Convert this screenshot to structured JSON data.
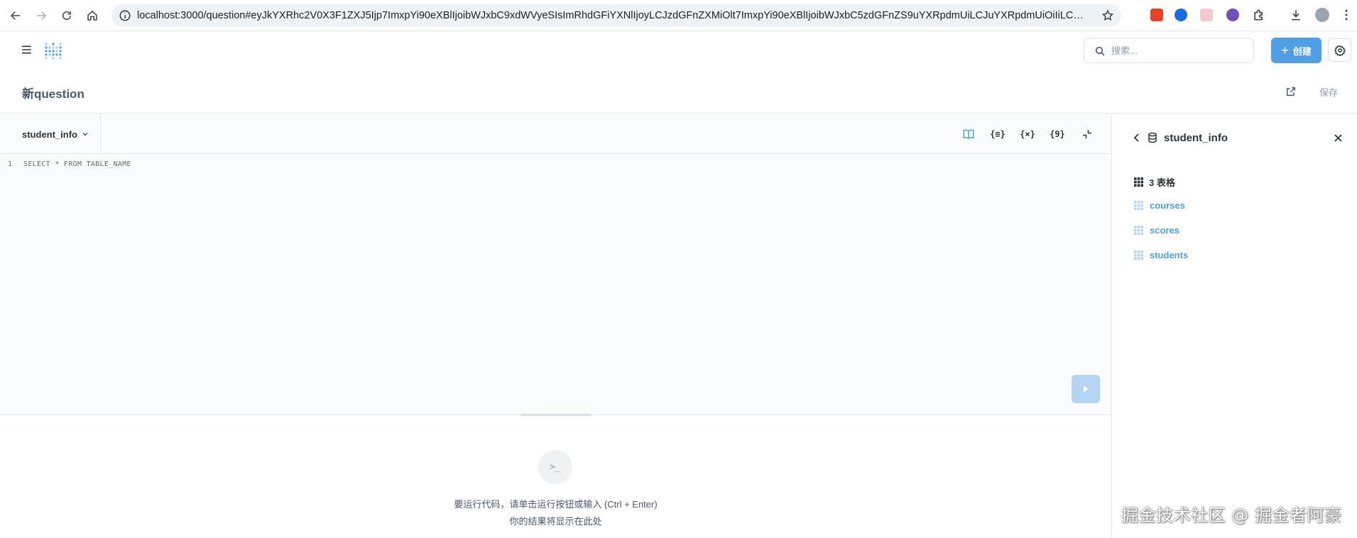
{
  "browser": {
    "url": "localhost:3000/question#eyJkYXRhc2V0X3F1ZXJ5Ijp7ImxpYi90eXBlIjoibWJxbC9xdWVyeSIsImRhdGFiYXNlIjoyLCJzdGFnZXMiOlt7ImxpYi90eXBlIjoibWJxbC5zdGFnZS9uYXRpdmUiLCJuYXRpdmUiOiIiLCJ0Z..."
  },
  "header": {
    "search_placeholder": "搜索...",
    "create_label": "创建"
  },
  "title_bar": {
    "title": "新question",
    "save_label": "保存"
  },
  "editor": {
    "database": "student_info",
    "line_number": "1",
    "code": "SELECT * FROM TABLE_NAME",
    "toolbar_icons": [
      "book-icon",
      "snippet-icon",
      "variable-icon",
      "template-icon",
      "collapse-icon"
    ],
    "tool_labels": {
      "snippets": "{≡}",
      "variables": "{×}",
      "template": "{9}"
    }
  },
  "results": {
    "prompt_symbol": ">_",
    "line1": "要运行代码，请单击运行按钮或输入 (Ctrl + Enter)",
    "line2": "你的结果将显示在此处"
  },
  "sidebar": {
    "title": "student_info",
    "table_count": "3 表格",
    "tables": [
      "courses",
      "scores",
      "students"
    ]
  },
  "watermark": "掘金技术社区 @ 掘金者阿豪",
  "colors": {
    "brand": "#509ee3",
    "run_disabled": "#b3d4f2",
    "text": "#4c5773",
    "border": "#e3e5e8"
  }
}
